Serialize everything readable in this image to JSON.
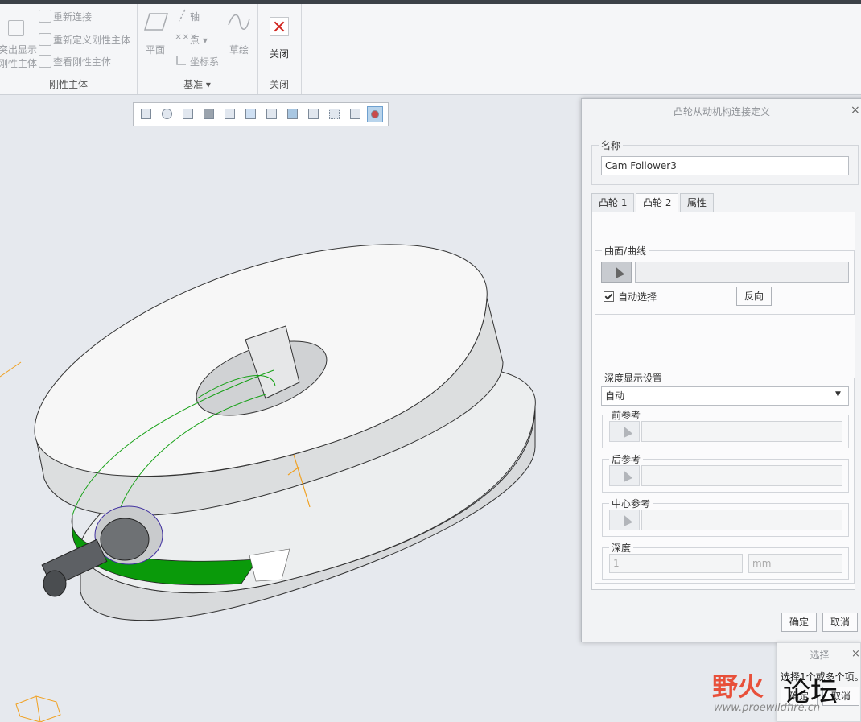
{
  "ribbon": {
    "groups": [
      {
        "label": "刚性主体",
        "items": [
          "突出显示刚性主体",
          "重新连接",
          "重新定义刚性主体",
          "查看刚性主体"
        ],
        "partial_left": [
          "突出显示",
          "刚性主体"
        ]
      },
      {
        "label": "基准",
        "items": [
          "平面",
          "轴",
          "点",
          "坐标系",
          "草绘"
        ]
      },
      {
        "label": "关闭",
        "items": [
          "关闭"
        ]
      }
    ]
  },
  "viewbar": {
    "tools": [
      "refit-icon",
      "zoom-out-icon",
      "repaint-icon",
      "orient-icon",
      "saved-views-icon",
      "display-style-icon",
      "section-icon",
      "appearance-icon",
      "plane-display-icon",
      "point-display-icon",
      "csys-display-icon",
      "connection-display-icon"
    ]
  },
  "dialog": {
    "title": "凸轮从动机构连接定义",
    "close": "×",
    "name_label": "名称",
    "name_value": "Cam Follower3",
    "tabs": [
      "凸轮 1",
      "凸轮 2",
      "属性"
    ],
    "active_tab": "凸轮 2",
    "surface_label": "曲面/曲线",
    "auto_select": "自动选择",
    "auto_select_checked": true,
    "flip_button": "反向",
    "depth_settings_label": "深度显示设置",
    "depth_mode": "自动",
    "front_ref": "前参考",
    "back_ref": "后参考",
    "center_ref": "中心参考",
    "depth_label": "深度",
    "depth_value": "1",
    "depth_unit": "mm",
    "ok": "确定",
    "cancel": "取消"
  },
  "select_popup": {
    "title": "选择",
    "message": "选择1个或多个项。",
    "ok": "确定",
    "cancel": "取消"
  },
  "watermark": {
    "brand": "野火",
    "forum": "论坛",
    "url": "www.proewildfire.cn"
  },
  "colors": {
    "accent_green": "#14a014",
    "axis_orange": "#f0a020",
    "brand_red": "#e8503a"
  }
}
